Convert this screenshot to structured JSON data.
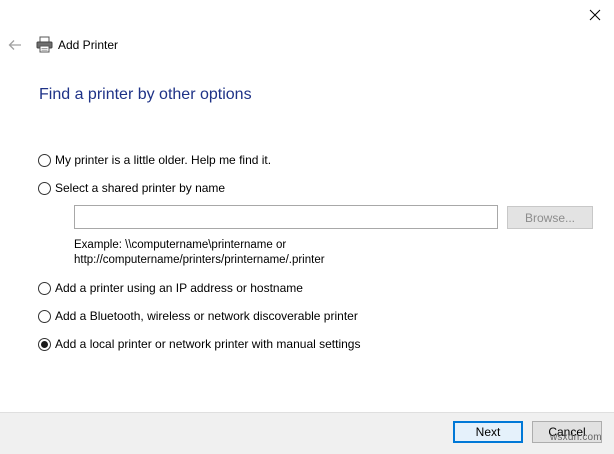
{
  "window": {
    "title": "Add Printer",
    "close_icon": "close-icon",
    "back_icon": "back-arrow-icon",
    "printer_icon": "printer-icon"
  },
  "heading": "Find a printer by other options",
  "options": [
    {
      "label": "My printer is a little older. Help me find it.",
      "checked": false
    },
    {
      "label": "Select a shared printer by name",
      "checked": false
    },
    {
      "label": "Add a printer using an IP address or hostname",
      "checked": false
    },
    {
      "label": "Add a Bluetooth, wireless or network discoverable printer",
      "checked": false
    },
    {
      "label": "Add a local printer or network printer with manual settings",
      "checked": true
    }
  ],
  "shared_printer": {
    "input_value": "",
    "browse_label": "Browse...",
    "example_line1": "Example: \\\\computername\\printername or",
    "example_line2": "http://computername/printers/printername/.printer"
  },
  "footer": {
    "next_label": "Next",
    "cancel_label": "Cancel"
  },
  "watermark": "wsxdn.com",
  "colors": {
    "heading": "#1e3287",
    "accent": "#0078d7",
    "footer_bg": "#f0f0f0"
  }
}
